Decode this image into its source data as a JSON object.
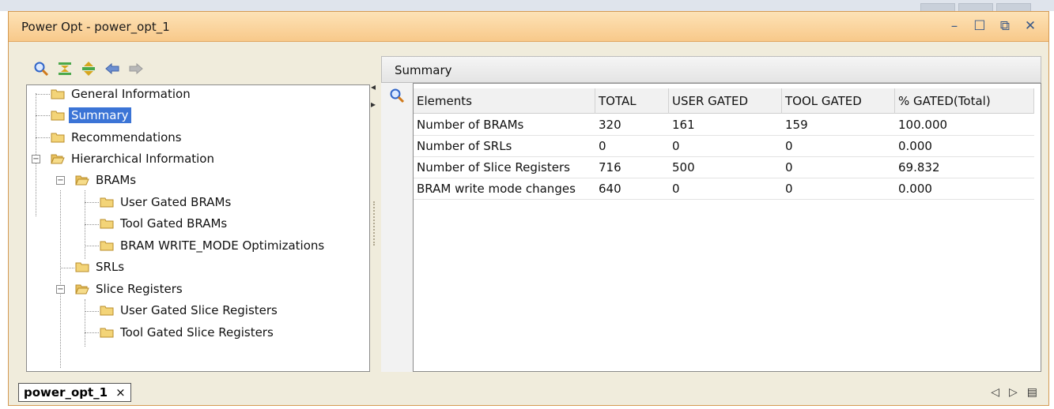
{
  "window": {
    "title": "Power Opt - power_opt_1",
    "controls": [
      "minimize",
      "maximize",
      "restore",
      "close"
    ]
  },
  "toolbar": [
    "search-icon",
    "collapse-all-icon",
    "expand-all-icon",
    "back-arrow-icon",
    "forward-arrow-icon"
  ],
  "tree": {
    "items": [
      {
        "label": "General Information"
      },
      {
        "label": "Summary",
        "selected": true
      },
      {
        "label": "Recommendations"
      },
      {
        "label": "Hierarchical Information",
        "expanded": true
      },
      {
        "label": "BRAMs",
        "expanded": true
      },
      {
        "label": "User Gated BRAMs"
      },
      {
        "label": "Tool Gated BRAMs"
      },
      {
        "label": "BRAM WRITE_MODE Optimizations"
      },
      {
        "label": "SRLs"
      },
      {
        "label": "Slice Registers",
        "expanded": true
      },
      {
        "label": "User Gated Slice Registers"
      },
      {
        "label": "Tool Gated Slice Registers"
      }
    ]
  },
  "summary": {
    "header": "Summary",
    "columns": [
      "Elements",
      "TOTAL",
      "USER GATED",
      "TOOL GATED",
      "% GATED(Total)"
    ],
    "rows": [
      [
        "Number of BRAMs",
        "320",
        "161",
        "159",
        "100.000"
      ],
      [
        "Number of SRLs",
        "0",
        "0",
        "0",
        "0.000"
      ],
      [
        "Number of Slice Registers",
        "716",
        "500",
        "0",
        "69.832"
      ],
      [
        "BRAM write mode changes",
        "640",
        "0",
        "0",
        "0.000"
      ]
    ]
  },
  "bottom_tab": {
    "label": "power_opt_1",
    "close": "×"
  }
}
